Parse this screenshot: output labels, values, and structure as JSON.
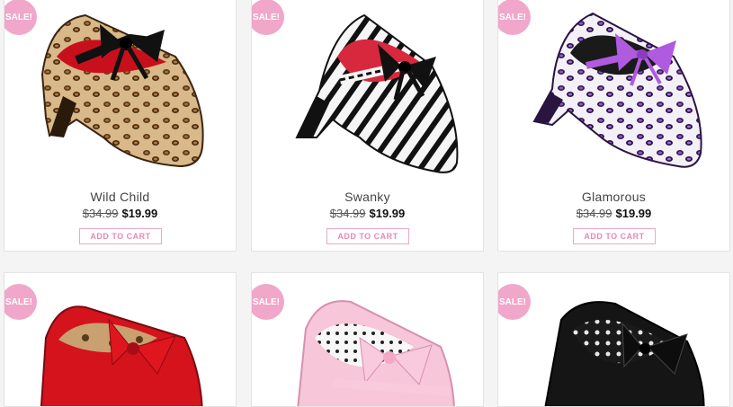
{
  "colors": {
    "accent": "#f0a7c9",
    "background": "#f4f4f4"
  },
  "products": [
    {
      "sale_badge": "SALE!",
      "name": "Wild Child",
      "old_price": "$34.99",
      "price": "$19.99",
      "button": "ADD TO CART",
      "image_icon": "leopard-shoe-image"
    },
    {
      "sale_badge": "SALE!",
      "name": "Swanky",
      "old_price": "$34.99",
      "price": "$19.99",
      "button": "ADD TO CART",
      "image_icon": "zebra-shoe-image"
    },
    {
      "sale_badge": "SALE!",
      "name": "Glamorous",
      "old_price": "$34.99",
      "price": "$19.99",
      "button": "ADD TO CART",
      "image_icon": "purple-leopard-shoe-image"
    },
    {
      "sale_badge": "SALE!",
      "image_icon": "red-shoe-image"
    },
    {
      "sale_badge": "SALE!",
      "image_icon": "pink-polka-shoe-image"
    },
    {
      "sale_badge": "SALE!",
      "image_icon": "black-shoe-image"
    }
  ]
}
